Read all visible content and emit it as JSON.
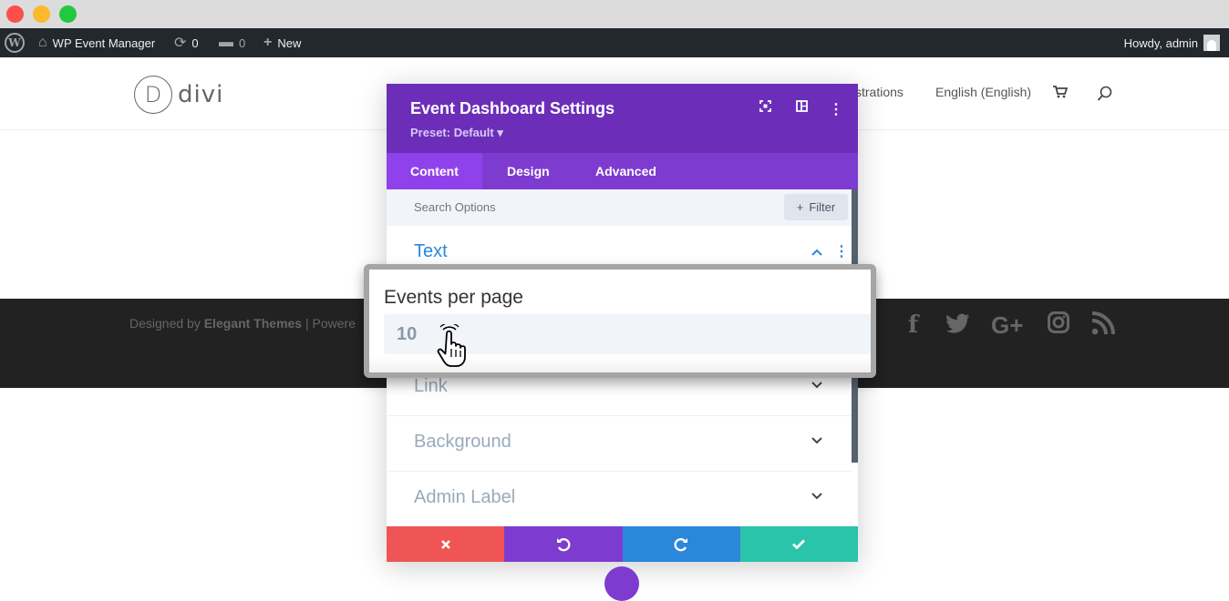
{
  "admin_bar": {
    "site_name": "WP Event Manager",
    "updates_count": "0",
    "comments_count": "0",
    "new_label": "New",
    "howdy": "Howdy, admin"
  },
  "header": {
    "logo_letter": "D",
    "logo_text": "divi",
    "nav_registrations": "strations",
    "nav_language": "English (English)",
    "cart_icon": "cart-icon",
    "search_icon": "search-icon"
  },
  "footer": {
    "credit_prefix": "Designed by ",
    "credit_brand": "Elegant Themes",
    "credit_suffix": " | Powere",
    "social": [
      "facebook-icon",
      "twitter-icon",
      "google-plus-icon",
      "instagram-icon",
      "rss-icon"
    ]
  },
  "panel": {
    "title": "Event Dashboard Settings",
    "preset": "Preset: Default ▾",
    "tabs": [
      {
        "label": "Content",
        "active": true
      },
      {
        "label": "Design",
        "active": false
      },
      {
        "label": "Advanced",
        "active": false
      }
    ],
    "search_placeholder": "Search Options",
    "filter_label": "Filter",
    "sections": [
      {
        "label": "Text",
        "open": true
      },
      {
        "label": "Link",
        "open": false
      },
      {
        "label": "Background",
        "open": false
      },
      {
        "label": "Admin Label",
        "open": false
      }
    ]
  },
  "zoom": {
    "field_label": "Events per page",
    "field_value": "10"
  },
  "colors": {
    "panel_header": "#6c2eb9",
    "tabs_bar": "#7e3bd0",
    "cancel": "#ef5555",
    "undo": "#7e3bd0",
    "redo": "#2b87da",
    "save": "#29c4a9"
  }
}
